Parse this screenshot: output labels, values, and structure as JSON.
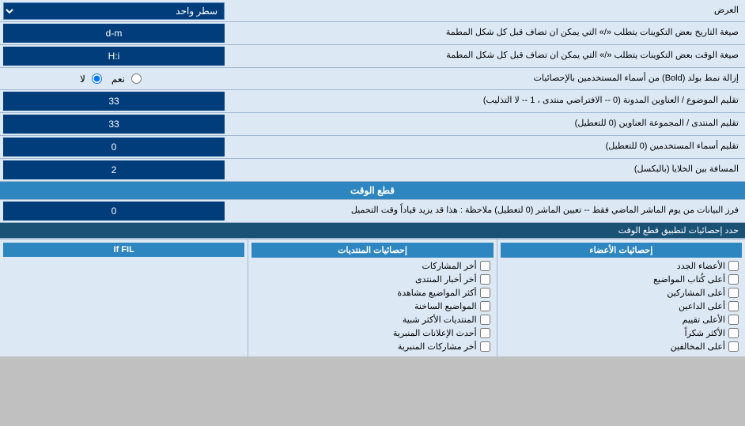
{
  "header": {
    "title": "العرض",
    "select_label": "سطر واحد"
  },
  "rows": [
    {
      "label": "صيغة التاريخ\nبعض التكوينات يتطلب «/» التي يمكن ان تضاف قبل كل شكل المطمة",
      "value": "d-m",
      "type": "text"
    },
    {
      "label": "صيغة الوقت\nبعض التكوينات يتطلب «/» التي يمكن ان تضاف قبل كل شكل المطمة",
      "value": "H:i",
      "type": "text"
    },
    {
      "label": "إزالة نمط بولد (Bold) من أسماء المستخدمين بالإحصائيات",
      "radio_yes": "نعم",
      "radio_no": "لا",
      "default_no": true,
      "type": "radio"
    },
    {
      "label": "تقليم الموضوع / العناوين المدونة (0 -- الافتراضي منتدى ، 1 -- لا التذليب)",
      "value": "33",
      "type": "text"
    },
    {
      "label": "تقليم المنتدى / المجموعة العناوين (0 للتعطيل)",
      "value": "33",
      "type": "text"
    },
    {
      "label": "تقليم أسماء المستخدمين (0 للتعطيل)",
      "value": "0",
      "type": "text"
    },
    {
      "label": "المسافة بين الخلايا (بالبكسل)",
      "value": "2",
      "type": "text"
    }
  ],
  "time_cut_section": "قطع الوقت",
  "time_cut_row": {
    "label": "فرز البيانات من يوم الماشر الماضي فقط -- تعيين الماشر (0 لتعطيل)\nملاحظة : هذا قد يزيد قياداً وقت التحميل",
    "value": "0",
    "type": "text"
  },
  "filter_note": "حدد إحصائيات لتطبيق قطع الوقت",
  "cols": {
    "left": {
      "header": "إحصائيات الأعضاء",
      "items": [
        "الأعضاء الجدد",
        "أعلى كُتاب المواضيع",
        "أعلى المشاركين",
        "أعلى الداعين",
        "الأعلى تقييم",
        "الأكثر شكراً",
        "أعلى المخالفين"
      ]
    },
    "middle": {
      "header": "إحصائيات المنتديات",
      "items": [
        "أخر المشاركات",
        "أخر أخبار المنتدى",
        "أكثر المواضيع مشاهدة",
        "المواضيع الساخنة",
        "المنتديات الأكثر شبية",
        "أحدث الإعلانات المنبرية",
        "أخر مشاركات المنبرية"
      ]
    },
    "right": {
      "header": "If FIL",
      "items": []
    }
  }
}
